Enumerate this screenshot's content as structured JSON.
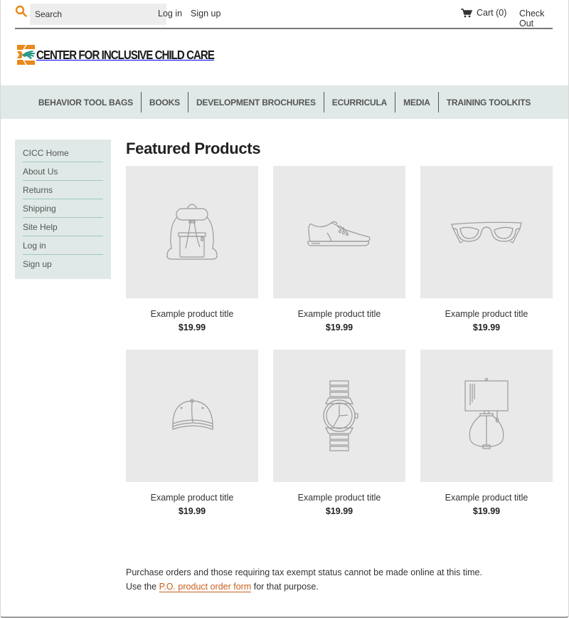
{
  "topbar": {
    "search_placeholder": "Search",
    "search_icon": "search-icon",
    "login_label": "Log in",
    "signup_label": "Sign up",
    "cart_icon": "cart-icon",
    "cart_label": "Cart (0)",
    "checkout_label": "Check Out"
  },
  "logo": {
    "text": "CENTER FOR INCLUSIVE CHILD CARE",
    "icon": "hand-logo-icon"
  },
  "nav": {
    "items": [
      {
        "label": "BEHAVIOR TOOL BAGS"
      },
      {
        "label": "BOOKS"
      },
      {
        "label": "DEVELOPMENT BROCHURES"
      },
      {
        "label": "ECURRICULA"
      },
      {
        "label": "MEDIA"
      },
      {
        "label": "TRAINING TOOLKITS"
      }
    ]
  },
  "sidebar": {
    "items": [
      {
        "label": "CICC Home"
      },
      {
        "label": "About Us"
      },
      {
        "label": "Returns"
      },
      {
        "label": "Shipping"
      },
      {
        "label": "Site Help"
      },
      {
        "label": "Log in"
      },
      {
        "label": "Sign up"
      }
    ]
  },
  "main": {
    "title": "Featured Products",
    "products": [
      {
        "title": "Example product title",
        "price": "$19.99",
        "icon": "backpack-icon"
      },
      {
        "title": "Example product title",
        "price": "$19.99",
        "icon": "sneaker-icon"
      },
      {
        "title": "Example product title",
        "price": "$19.99",
        "icon": "glasses-icon"
      },
      {
        "title": "Example product title",
        "price": "$19.99",
        "icon": "cap-icon"
      },
      {
        "title": "Example product title",
        "price": "$19.99",
        "icon": "watch-icon"
      },
      {
        "title": "Example product title",
        "price": "$19.99",
        "icon": "lamp-icon"
      }
    ],
    "notice": {
      "line1": "Purchase orders and those requiring tax exempt status cannot be made online at this time.",
      "line2_before": "Use the ",
      "link_text": "P.O. product order form",
      "line2_after": " for that purpose."
    }
  },
  "colors": {
    "accent_orange": "#e8891a",
    "logo_green": "#2a9a8a",
    "nav_bg": "#e0e9e7",
    "link_orange": "#c8601f",
    "placeholder_gray": "#e9e9e9"
  }
}
